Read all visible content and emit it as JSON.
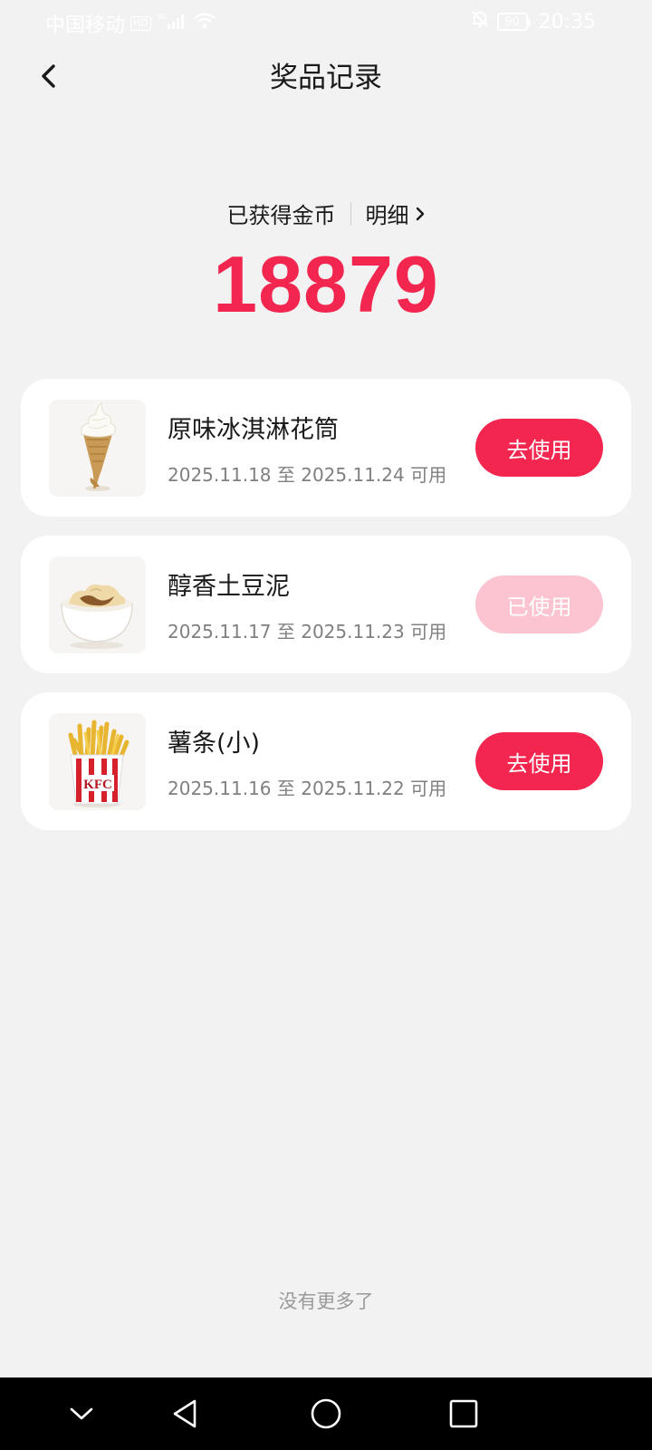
{
  "status_bar": {
    "carrier": "中国移动",
    "hd_badge": "HD",
    "network": "4G",
    "battery": "90",
    "time": "20:35"
  },
  "header": {
    "title": "奖品记录"
  },
  "coins": {
    "label": "已获得金币",
    "detail_link": "明细",
    "value": "18879"
  },
  "prizes": [
    {
      "name": "原味冰淇淋花筒",
      "validity": "2025.11.18 至 2025.11.24 可用",
      "action": "去使用",
      "used": false,
      "image": "ice-cream-cone"
    },
    {
      "name": "醇香土豆泥",
      "validity": "2025.11.17 至 2025.11.23 可用",
      "action": "已使用",
      "used": true,
      "image": "mashed-potato-bowl"
    },
    {
      "name": "薯条(小)",
      "validity": "2025.11.16 至 2025.11.22 可用",
      "action": "去使用",
      "used": false,
      "image": "french-fries"
    }
  ],
  "footer": {
    "no_more": "没有更多了"
  },
  "colors": {
    "accent": "#f2264f",
    "accent_disabled": "#fbc4d0",
    "background": "#f2f2f2"
  }
}
